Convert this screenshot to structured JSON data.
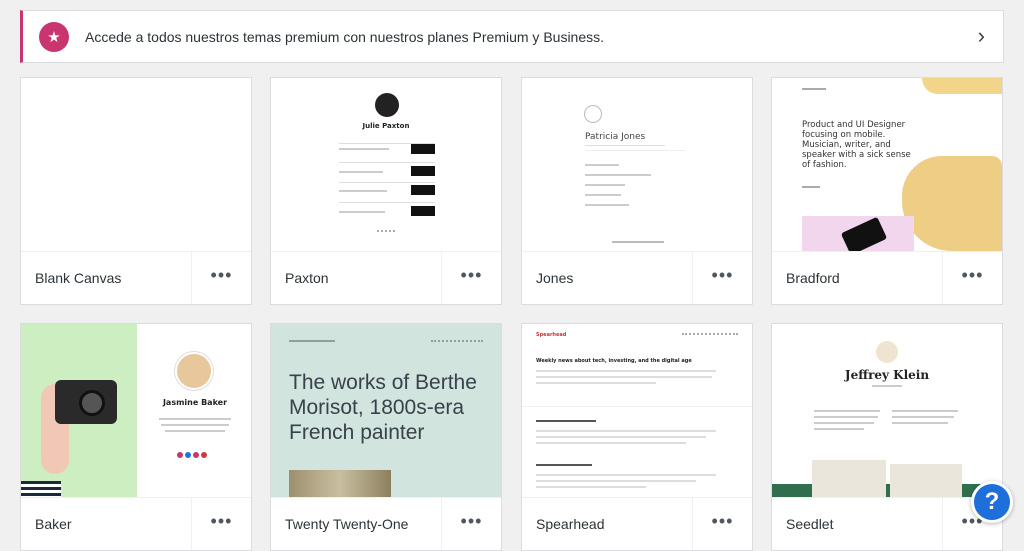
{
  "banner": {
    "text": "Accede a todos nuestros temas premium con nuestros planes Premium y Business.",
    "icon": "star-icon",
    "accent": "#c9356e"
  },
  "themes": [
    {
      "name": "Blank Canvas"
    },
    {
      "name": "Paxton",
      "preview_title": "Julie Paxton"
    },
    {
      "name": "Jones",
      "preview_title": "Patricia Jones"
    },
    {
      "name": "Bradford",
      "preview_text": "Product and UI Designer focusing on mobile. Musician, writer, and speaker with a sick sense of fashion."
    },
    {
      "name": "Baker",
      "preview_title": "Jasmine Baker"
    },
    {
      "name": "Twenty Twenty-One",
      "preview_text": "The works of Berthe Morisot, 1800s-era French painter"
    },
    {
      "name": "Spearhead",
      "preview_brand": "Spearhead",
      "preview_heading": "Weekly news about tech, investing, and the digital age"
    },
    {
      "name": "Seedlet",
      "preview_title": "Jeffrey Klein"
    }
  ],
  "more_label": "•••",
  "help_label": "?"
}
